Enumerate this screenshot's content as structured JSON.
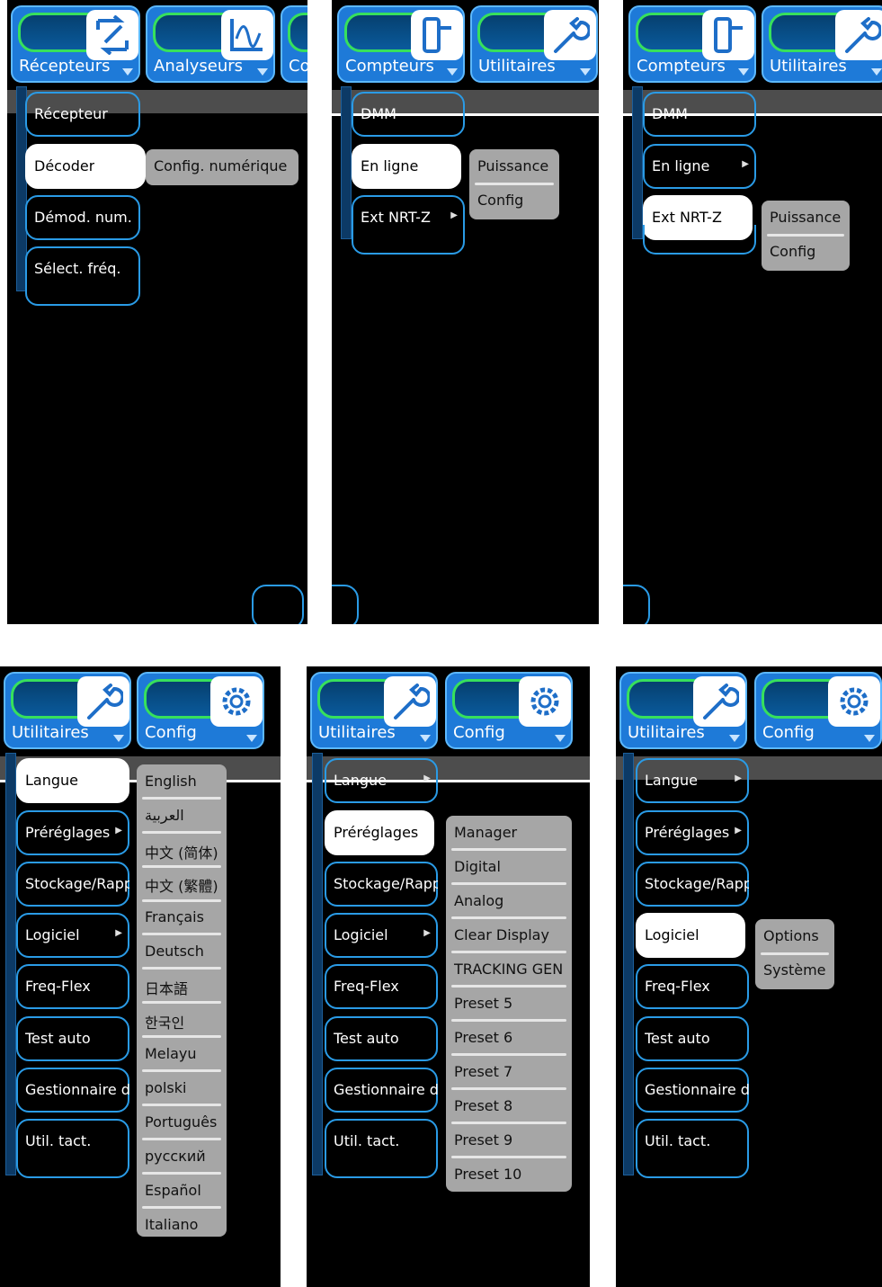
{
  "colors": {
    "tab": "#1e7ad8",
    "glow": "#37e05c",
    "menu_border": "#2a9be6",
    "submenu": "#a6a6a6",
    "background": "#000000"
  },
  "p1": {
    "tabs": [
      {
        "label": "Récepteurs",
        "icon": "receiver-icon"
      },
      {
        "label": "Analyseurs",
        "icon": "analyzer-icon"
      },
      {
        "label": "Co",
        "icon": "meter-icon"
      }
    ],
    "items": [
      "Récepteur",
      "Décoder",
      "Démod. num.",
      "Sélect. fréq."
    ],
    "selected": 1,
    "sub": [
      "Config. numérique"
    ]
  },
  "p2": {
    "tabs": [
      {
        "label": "Compteurs",
        "icon": "meter-icon"
      },
      {
        "label": "Utilitaires",
        "icon": "wrench-icon"
      }
    ],
    "items": [
      "DMM",
      "En ligne",
      "Ext NRT-Z"
    ],
    "selected": 1,
    "sub": [
      "Puissance",
      "Config"
    ]
  },
  "p3": {
    "tabs": [
      {
        "label": "Compteurs",
        "icon": "meter-icon"
      },
      {
        "label": "Utilitaires",
        "icon": "wrench-icon"
      }
    ],
    "items": [
      "DMM",
      "En ligne",
      "Ext NRT-Z"
    ],
    "selected": 2,
    "sub": [
      "Puissance",
      "Config"
    ]
  },
  "p4": {
    "tabs": [
      {
        "label": "Utilitaires",
        "icon": "wrench-icon"
      },
      {
        "label": "Config",
        "icon": "gear-icon"
      }
    ],
    "items": [
      "Langue",
      "Préréglages",
      "Stockage/Rapp",
      "Logiciel",
      "Freq-Flex",
      "Test auto",
      "Gestionnaire d",
      "Util. tact."
    ],
    "selected": 0,
    "sub": [
      "English",
      "العربية",
      "中文 (简体)",
      "中文 (繁體)",
      "Français",
      "Deutsch",
      "日本語",
      "한국인",
      "Melayu",
      "polski",
      "Português",
      "русский",
      "Español",
      "Italiano"
    ]
  },
  "p5": {
    "tabs": [
      {
        "label": "Utilitaires",
        "icon": "wrench-icon"
      },
      {
        "label": "Config",
        "icon": "gear-icon"
      }
    ],
    "items": [
      "Langue",
      "Préréglages",
      "Stockage/Rapp",
      "Logiciel",
      "Freq-Flex",
      "Test auto",
      "Gestionnaire d",
      "Util. tact."
    ],
    "selected": 1,
    "sub": [
      "Manager",
      "Digital",
      "Analog",
      "Clear Display",
      "TRACKING GEN",
      "Preset 5",
      "Preset 6",
      "Preset 7",
      "Preset 8",
      "Preset 9",
      "Preset 10"
    ]
  },
  "p6": {
    "tabs": [
      {
        "label": "Utilitaires",
        "icon": "wrench-icon"
      },
      {
        "label": "Config",
        "icon": "gear-icon"
      }
    ],
    "items": [
      "Langue",
      "Préréglages",
      "Stockage/Rapp",
      "Logiciel",
      "Freq-Flex",
      "Test auto",
      "Gestionnaire d",
      "Util. tact."
    ],
    "selected": 3,
    "sub": [
      "Options",
      "Système"
    ]
  }
}
